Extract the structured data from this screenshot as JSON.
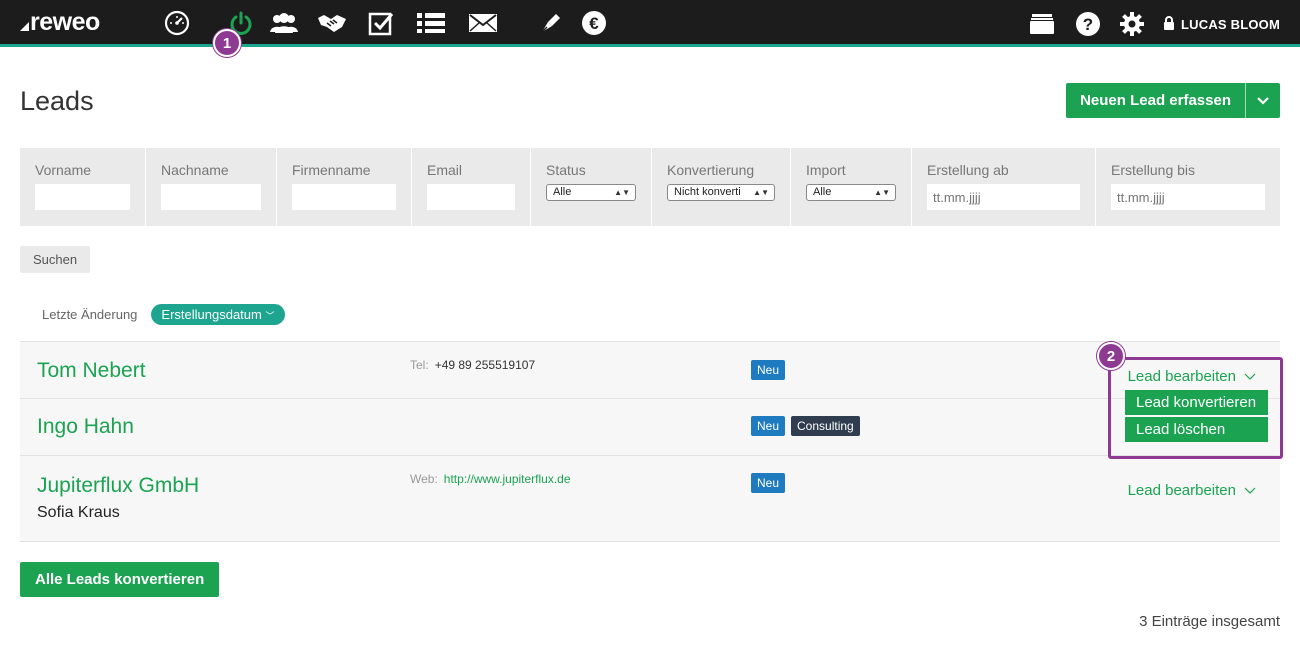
{
  "app": {
    "logo_text": "reweo",
    "brand_color": "#1ba352",
    "accent_teal": "#1ea58f",
    "annotation_color": "#8e3a92"
  },
  "nav": {
    "icons": [
      "dashboard-icon",
      "power-icon",
      "contacts-icon",
      "handshake-icon",
      "tasks-icon",
      "list-icon",
      "mail-icon",
      "pen-icon",
      "euro-icon"
    ],
    "active_icon": "power-icon",
    "right_icons": [
      "folder-icon",
      "help-icon",
      "settings-icon",
      "lock-icon"
    ],
    "user_name": "LUCAS BLOOM"
  },
  "annotations": {
    "marker_1": "1",
    "marker_2": "2"
  },
  "page": {
    "title": "Leads",
    "new_lead_button": "Neuen Lead erfassen"
  },
  "filters": {
    "first_name": {
      "label": "Vorname",
      "value": ""
    },
    "last_name": {
      "label": "Nachname",
      "value": ""
    },
    "company": {
      "label": "Firmenname",
      "value": ""
    },
    "email": {
      "label": "Email",
      "value": ""
    },
    "status": {
      "label": "Status",
      "selected": "Alle"
    },
    "conversion": {
      "label": "Konvertierung",
      "selected": "Nicht konverti"
    },
    "import": {
      "label": "Import",
      "selected": "Alle"
    },
    "created_from": {
      "label": "Erstellung ab",
      "placeholder": "tt.mm.jjjj"
    },
    "created_to": {
      "label": "Erstellung bis",
      "placeholder": "tt.mm.jjjj"
    },
    "search_button": "Suchen"
  },
  "sort": {
    "option_last_change": "Letzte Änderung",
    "option_created": "Erstellungsdatum"
  },
  "leads": [
    {
      "name": "Tom Nebert",
      "contact_label": "Tel:",
      "contact_value": "+49 89 255519107",
      "badges": [
        "Neu"
      ],
      "action": "Lead bearbeiten"
    },
    {
      "name": "Ingo Hahn",
      "badges": [
        "Neu",
        "Consulting"
      ]
    },
    {
      "name": "Jupiterflux GmbH",
      "subname": "Sofia Kraus",
      "contact_label": "Web:",
      "contact_value": "http://www.jupiterflux.de",
      "badges": [
        "Neu"
      ],
      "action": "Lead bearbeiten"
    }
  ],
  "dropdown": {
    "convert": "Lead konvertieren",
    "delete": "Lead löschen"
  },
  "footer": {
    "convert_all_button": "Alle Leads konvertieren",
    "total": "3 Einträge insgesamt"
  }
}
